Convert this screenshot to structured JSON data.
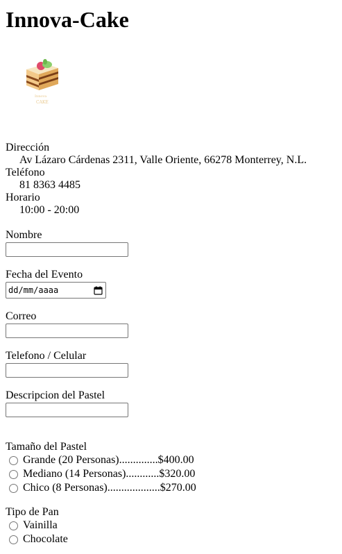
{
  "header": {
    "title": "Innova-Cake"
  },
  "logo": {
    "icon": "cake-slice-logo-icon"
  },
  "info": {
    "address_label": "Dirección",
    "address_value": "Av Lázaro Cárdenas 2311, Valle Oriente, 66278 Monterrey, N.L.",
    "phone_label": "Teléfono",
    "phone_value": "81 8363 4485",
    "hours_label": "Horario",
    "hours_value": "10:00 - 20:00"
  },
  "form": {
    "name_label": "Nombre",
    "name_value": "",
    "event_date_label": "Fecha del Evento",
    "event_date_placeholder": "dd/mm/aaaa",
    "email_label": "Correo",
    "email_value": "",
    "phone_label": "Telefono / Celular",
    "phone_value": "",
    "description_label": "Descripcion del Pastel",
    "description_value": "",
    "size": {
      "label": "Tamaño del Pastel",
      "options": [
        "Grande (20 Personas)..............$400.00",
        "Mediano (14 Personas)............$320.00",
        "Chico (8 Personas)...................$270.00"
      ]
    },
    "bread": {
      "label": "Tipo de Pan",
      "options": [
        "Vainilla",
        "Chocolate"
      ]
    }
  }
}
